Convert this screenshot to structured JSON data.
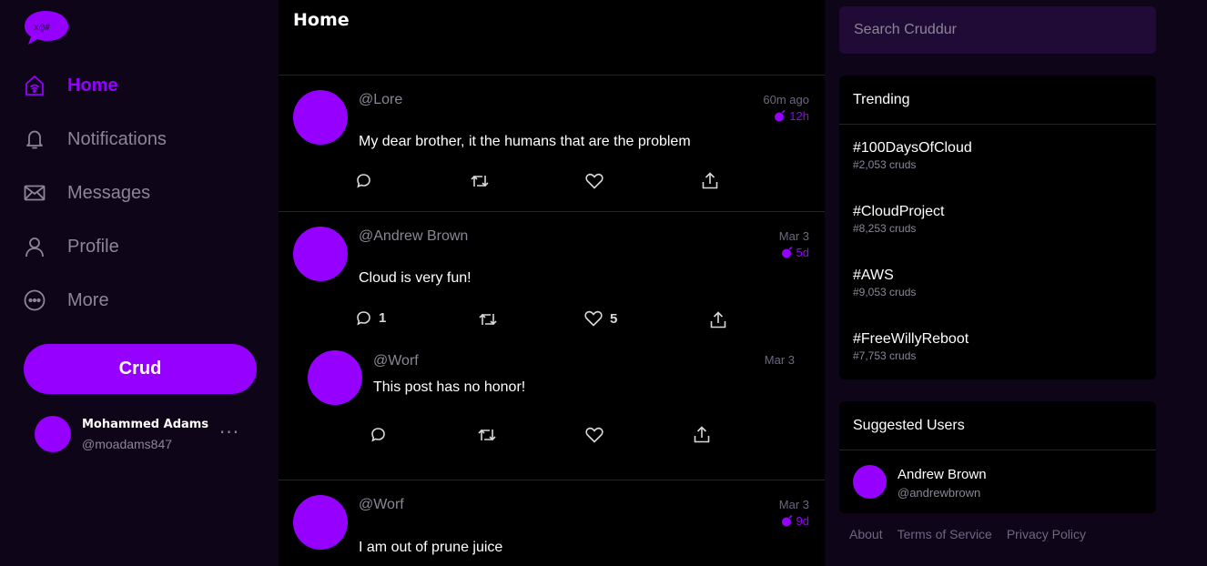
{
  "brand": {
    "accent": "#9500ff",
    "logo_icon": "speech-bubble-logo-icon"
  },
  "sidebar": {
    "items": [
      {
        "label": "Home",
        "icon": "home-icon",
        "active": true
      },
      {
        "label": "Notifications",
        "icon": "bell-icon",
        "active": false
      },
      {
        "label": "Messages",
        "icon": "envelope-icon",
        "active": false
      },
      {
        "label": "Profile",
        "icon": "person-icon",
        "active": false
      },
      {
        "label": "More",
        "icon": "more-circle-icon",
        "active": false
      }
    ],
    "crud_button": "Crud",
    "profile": {
      "name": "Mohammed Adams",
      "handle": "@moadams847",
      "more": "···"
    }
  },
  "feed": {
    "title": "Home",
    "activities": [
      {
        "handle": "@Lore",
        "message": "My dear brother, it the humans that are the problem",
        "created": "60m ago",
        "expires": "12h",
        "replies": "",
        "reposts": "",
        "likes": ""
      },
      {
        "handle": "@Andrew Brown",
        "message": "Cloud is very fun!",
        "created": "Mar 3",
        "expires": "5d",
        "replies": "1",
        "reposts": "",
        "likes": "5"
      },
      {
        "handle": "@Worf",
        "message": "This post has no honor!",
        "created": "Mar 3",
        "expires": "",
        "replies": "",
        "reposts": "",
        "likes": ""
      },
      {
        "handle": "@Worf",
        "message": "I am out of prune juice",
        "created": "Mar 3",
        "expires": "9d",
        "replies": "",
        "reposts": "",
        "likes": ""
      }
    ]
  },
  "search": {
    "placeholder": "Search Cruddur"
  },
  "trending": {
    "title": "Trending",
    "items": [
      {
        "tag": "#100DaysOfCloud",
        "count": "#2,053 cruds"
      },
      {
        "tag": "#CloudProject",
        "count": "#8,253 cruds"
      },
      {
        "tag": "#AWS",
        "count": "#9,053 cruds"
      },
      {
        "tag": "#FreeWillyReboot",
        "count": "#7,753 cruds"
      }
    ]
  },
  "suggested": {
    "title": "Suggested Users",
    "users": [
      {
        "name": "Andrew Brown",
        "handle": "@andrewbrown"
      }
    ]
  },
  "footer": {
    "links": [
      "About",
      "Terms of Service",
      "Privacy Policy"
    ]
  }
}
